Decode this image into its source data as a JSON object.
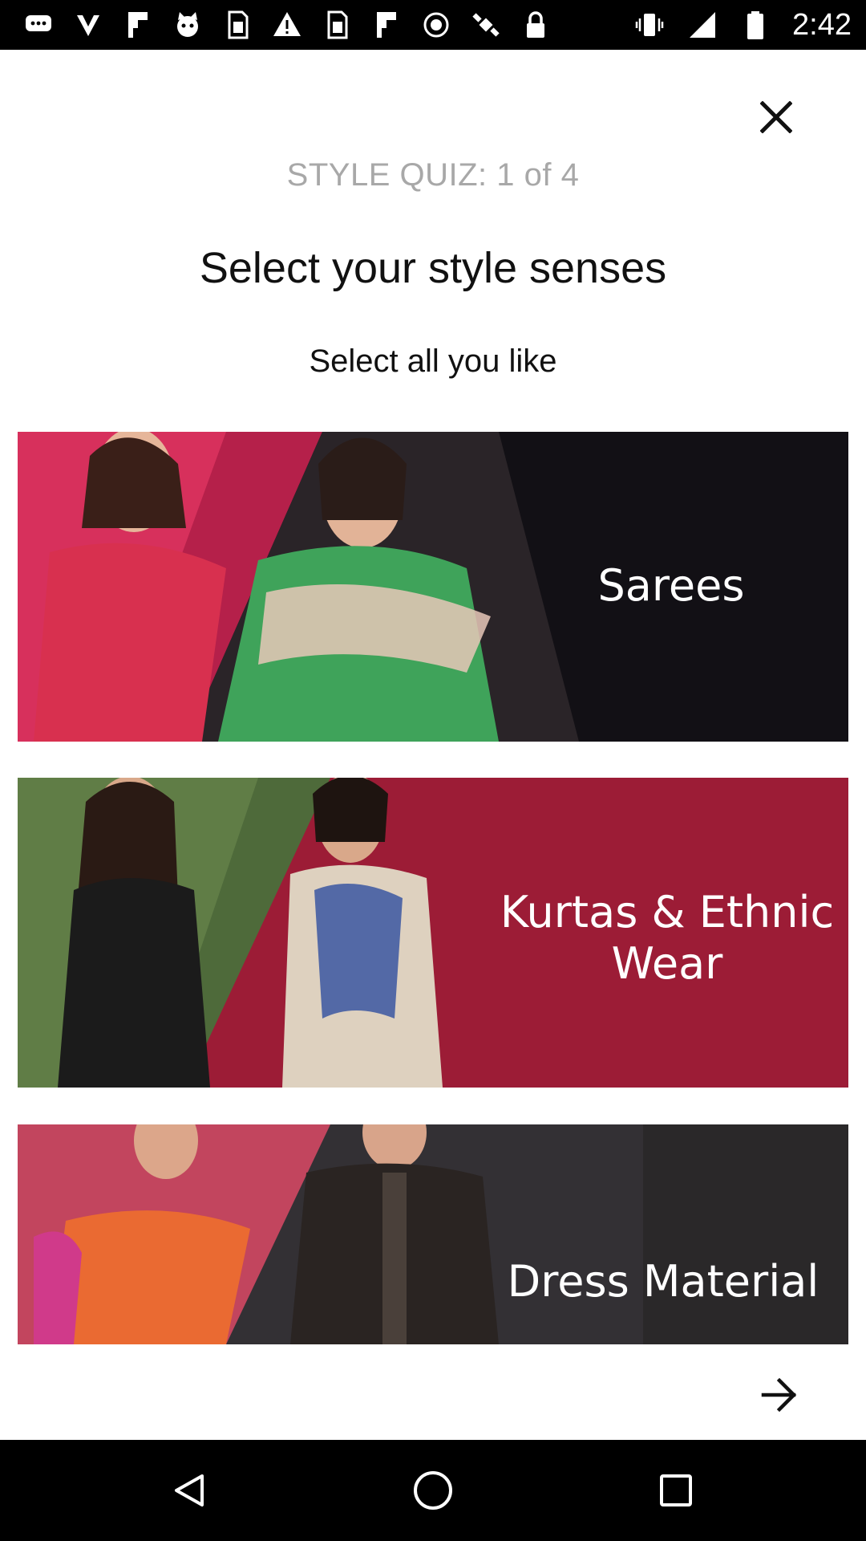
{
  "status_bar": {
    "time": "2:42",
    "left_icons": [
      "messages-icon",
      "check-icon",
      "flipboard-icon",
      "cat-icon",
      "sim-icon",
      "warning-icon",
      "sim-icon",
      "flipboard-icon",
      "record-icon",
      "fake-gps-icon",
      "lock-icon"
    ],
    "right_icons": [
      "vibrate-icon",
      "signal-icon",
      "battery-icon"
    ]
  },
  "quiz": {
    "step_label": "STYLE QUIZ: 1 of 4",
    "title": "Select your style senses",
    "subtitle": "Select all you like"
  },
  "categories": [
    {
      "label": "Sarees",
      "bg": "#121015"
    },
    {
      "label_line1": "Kurtas & Ethnic",
      "label_line2": "Wear",
      "bg": "#9c1c36"
    },
    {
      "label": "Dress Material",
      "bg": "#333034"
    }
  ],
  "colors": {
    "status_bar": "#000000",
    "nav_bar": "#000000",
    "step_label": "#a8a8a8",
    "text": "#111111"
  }
}
